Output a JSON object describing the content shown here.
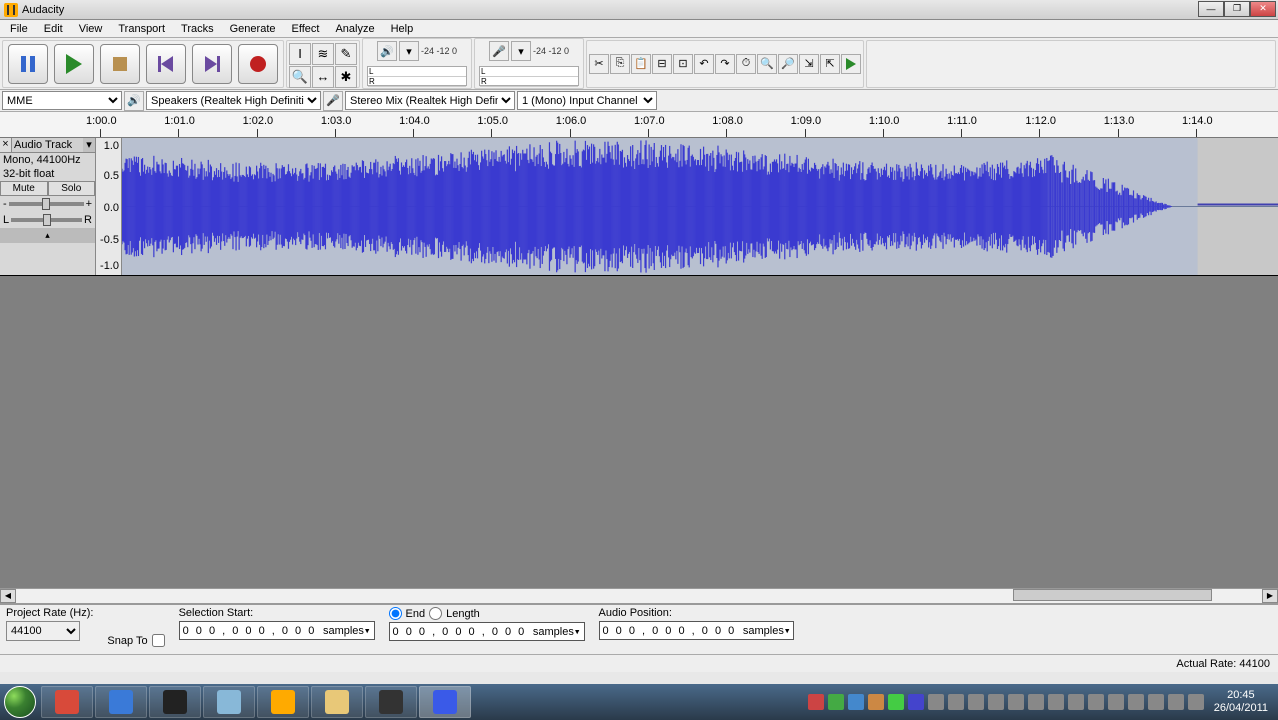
{
  "title": "Audacity",
  "menus": [
    "File",
    "Edit",
    "View",
    "Transport",
    "Tracks",
    "Generate",
    "Effect",
    "Analyze",
    "Help"
  ],
  "meter_labels": {
    "left": "L",
    "right": "R",
    "scale": "-24   -12   0"
  },
  "host_api": "MME",
  "output_device": "Speakers (Realtek High Definiti",
  "input_device": "Stereo Mix (Realtek High Definit",
  "input_channels": "1 (Mono) Input Channel",
  "ruler_start": 60.0,
  "ruler_increment": 1.0,
  "ruler_count": 15,
  "track": {
    "name": "Audio Track",
    "info_line1": "Mono, 44100Hz",
    "info_line2": "32-bit float",
    "mute": "Mute",
    "solo": "Solo",
    "gain_labels": {
      "minus": "-",
      "plus": "+"
    },
    "pan_labels": {
      "left": "L",
      "right": "R"
    }
  },
  "vscale": [
    "1.0",
    "0.5",
    "0.0",
    "-0.5",
    "-1.0"
  ],
  "selection": {
    "rate_label": "Project Rate (Hz):",
    "rate": "44100",
    "snap_label": "Snap To",
    "start_label": "Selection Start:",
    "end_label": "End",
    "length_label": "Length",
    "pos_label": "Audio Position:",
    "time_value": "0 0 0 , 0 0 0 , 0 0 0",
    "time_unit": "samples"
  },
  "status": {
    "actual_rate": "Actual Rate: 44100"
  },
  "taskbar": {
    "apps": [
      {
        "name": "chrome",
        "color": "#d84a3a"
      },
      {
        "name": "ie",
        "color": "#3a7ad8"
      },
      {
        "name": "movie",
        "color": "#222"
      },
      {
        "name": "notepad",
        "color": "#88b8d8"
      },
      {
        "name": "audacity",
        "color": "#ffaa00"
      },
      {
        "name": "folder",
        "color": "#e8c878"
      },
      {
        "name": "cmd",
        "color": "#333"
      },
      {
        "name": "camtasia",
        "color": "#3a5ae8"
      }
    ],
    "time": "20:45",
    "date": "26/04/2011"
  }
}
